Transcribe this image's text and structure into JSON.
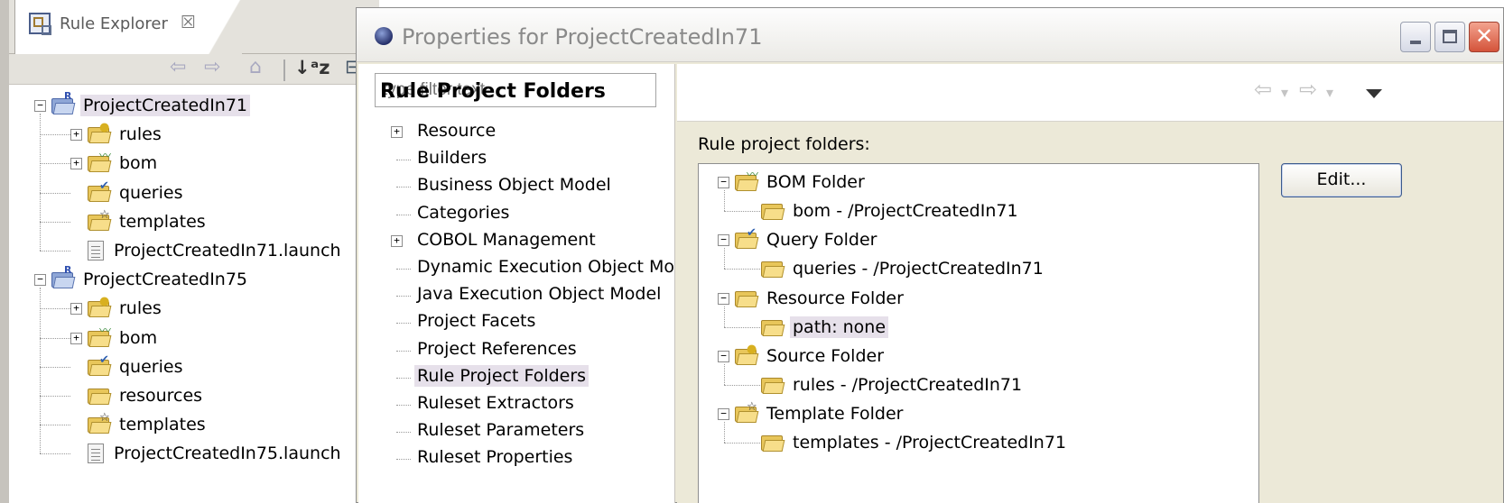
{
  "explorer": {
    "tab_label": "Rule Explorer",
    "tab_close": "☒",
    "toolbar": {
      "back": "⇦",
      "forward": "⇨",
      "home": "⌂",
      "sort": "↓ᵃz",
      "collapse": "⊟"
    },
    "tree": [
      {
        "label": "ProjectCreatedIn71",
        "kind": "project",
        "expander": "⊟"
      },
      {
        "label": "rules",
        "kind": "rules",
        "expander": "+"
      },
      {
        "label": "bom",
        "kind": "bom",
        "expander": "+"
      },
      {
        "label": "queries",
        "kind": "queries"
      },
      {
        "label": "templates",
        "kind": "templates"
      },
      {
        "label": "ProjectCreatedIn71.launch",
        "kind": "file"
      },
      {
        "label": "ProjectCreatedIn75",
        "kind": "project",
        "expander": "⊟"
      },
      {
        "label": "rules",
        "kind": "rules",
        "expander": "+"
      },
      {
        "label": "bom",
        "kind": "bom",
        "expander": "+"
      },
      {
        "label": "queries",
        "kind": "queries"
      },
      {
        "label": "resources",
        "kind": "resources"
      },
      {
        "label": "templates",
        "kind": "templates"
      },
      {
        "label": "ProjectCreatedIn75.launch",
        "kind": "file"
      }
    ]
  },
  "dialog": {
    "title": "Properties for ProjectCreatedIn71",
    "window_buttons": {
      "minimize": "_",
      "maximize": "□",
      "close": "✕"
    },
    "filter_placeholder": "type filter text",
    "nav": [
      {
        "label": "Resource",
        "expandable": true
      },
      {
        "label": "Builders"
      },
      {
        "label": "Business Object Model"
      },
      {
        "label": "Categories"
      },
      {
        "label": "COBOL Management",
        "expandable": true
      },
      {
        "label": "Dynamic Execution Object Mo"
      },
      {
        "label": "Java Execution Object Model"
      },
      {
        "label": "Project Facets"
      },
      {
        "label": "Project References"
      },
      {
        "label": "Rule Project Folders",
        "selected": true
      },
      {
        "label": "Ruleset Extractors"
      },
      {
        "label": "Ruleset Parameters"
      },
      {
        "label": "Ruleset Properties"
      }
    ],
    "page": {
      "title": "Rule Project Folders",
      "back_arrow": "⇦",
      "forward_arrow": "⇨",
      "dropdown": "▾",
      "folders_label": "Rule project folders:",
      "edit_button": "Edit...",
      "folders": [
        {
          "label": "BOM Folder",
          "kind": "bom",
          "child": "bom - /ProjectCreatedIn71"
        },
        {
          "label": "Query Folder",
          "kind": "queries",
          "child": "queries - /ProjectCreatedIn71"
        },
        {
          "label": "Resource Folder",
          "kind": "resources",
          "child": "path: none",
          "child_selected": true
        },
        {
          "label": "Source Folder",
          "kind": "rules",
          "child": "rules - /ProjectCreatedIn71"
        },
        {
          "label": "Template Folder",
          "kind": "templates",
          "child": "templates - /ProjectCreatedIn71"
        }
      ]
    }
  },
  "colors": {
    "selection": "#e6e0ea",
    "folder_yellow": "#e8c65a",
    "dialog_background": "#ece9d8"
  }
}
